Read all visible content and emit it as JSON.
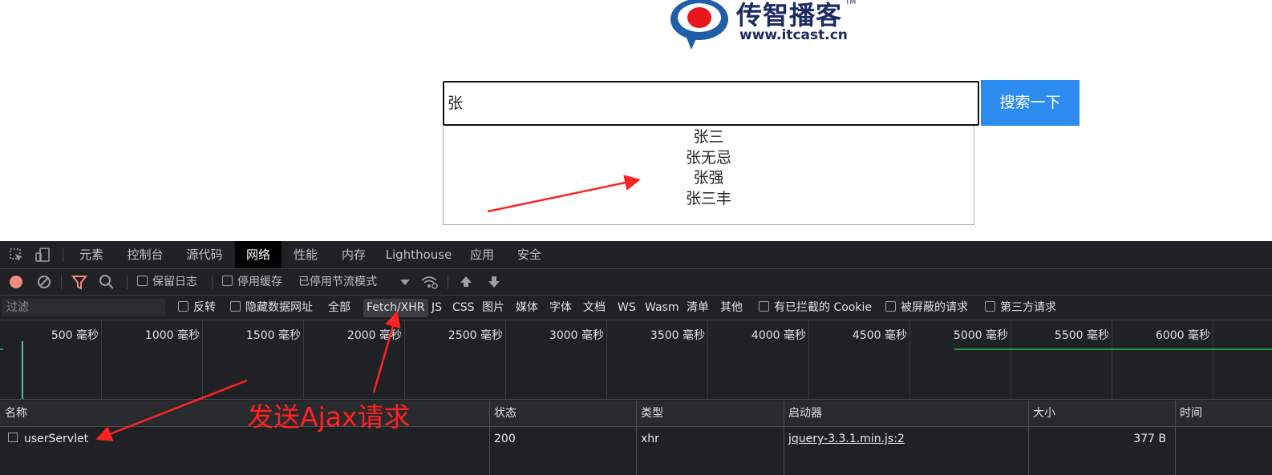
{
  "logo": {
    "name": "传智播客",
    "trademark": "TM",
    "url": "www.itcast.cn"
  },
  "search": {
    "value": "张",
    "button_label": "搜索一下"
  },
  "suggestions": [
    "张三",
    "张无忌",
    "张强",
    "张三丰"
  ],
  "devtools": {
    "tabs": [
      "元素",
      "控制台",
      "源代码",
      "网络",
      "性能",
      "内存",
      "Lighthouse",
      "应用",
      "安全"
    ],
    "active_tab": "网络",
    "toolbar": {
      "preserve_log": "保留日志",
      "disable_cache": "停用缓存",
      "throttle": "已停用节流模式"
    },
    "filter": {
      "placeholder": "过滤",
      "invert": "反转",
      "hide_data_urls": "隐藏数据网址",
      "types": [
        "全部",
        "Fetch/XHR",
        "JS",
        "CSS",
        "图片",
        "媒体",
        "字体",
        "文档",
        "WS",
        "Wasm",
        "清单",
        "其他"
      ],
      "active_type": "Fetch/XHR",
      "blocked_cookies": "有已拦截的 Cookie",
      "blocked_requests": "被屏蔽的请求",
      "third_party": "第三方请求"
    },
    "timeline_ticks": [
      "500 毫秒",
      "1000 毫秒",
      "1500 毫秒",
      "2000 毫秒",
      "2500 毫秒",
      "3000 毫秒",
      "3500 毫秒",
      "4000 毫秒",
      "4500 毫秒",
      "5000 毫秒",
      "5500 毫秒",
      "6000 毫秒"
    ],
    "columns": [
      "名称",
      "状态",
      "类型",
      "启动器",
      "大小",
      "时间"
    ],
    "rows": [
      {
        "name": "userServlet",
        "status": "200",
        "type": "xhr",
        "initiator": "jquery-3.3.1.min.js:2",
        "size": "377 B",
        "time": ""
      }
    ]
  },
  "annotation": {
    "text": "发送Ajax请求",
    "color": "#ff2222"
  },
  "colors": {
    "search_button": "#2d8cf0",
    "devtools_bg": "#202124",
    "logo": "#1d2b63"
  }
}
